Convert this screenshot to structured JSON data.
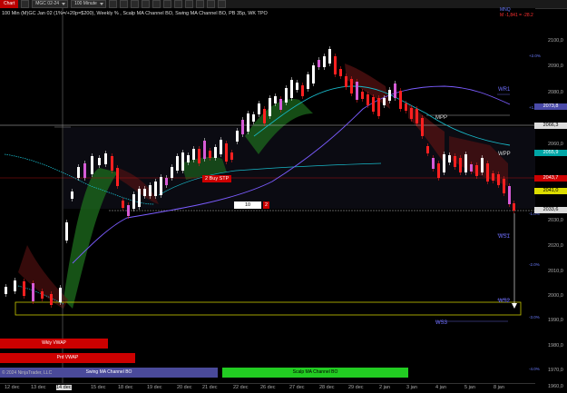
{
  "toolbar": {
    "chart_tab": "Chart",
    "instrument": "MGC 02-24",
    "interval": "100 Minute"
  },
  "caption": "100 Min (M)GC Jan 02 (1%=/+20p=$200), Weekly % , Scalp MA Channel BO, Swing MA Channel BO, PB 35p, WK TPO",
  "corner_top_right": {
    "label": "MNQ",
    "value": "M -1,841 = -28.2"
  },
  "price_axis": {
    "labels": [
      "2100,0",
      "2090,0",
      "2080,0",
      "2070,0",
      "2060,0",
      "2050,0",
      "2040,0",
      "2030,0",
      "2020,0",
      "2010,0",
      "2000,0",
      "1990,0",
      "1980,0",
      "1970,0",
      "1960,0"
    ],
    "percent_labels": [
      "+2.0%",
      "+1.0%",
      "-1.0%",
      "-2.0%",
      "-3.0%",
      "-4.0%"
    ],
    "tags": [
      {
        "text": "2073,8",
        "bg": "#4a4aa8",
        "fg": "#ffffff"
      },
      {
        "text": "2066,3",
        "bg": "#dddddd",
        "fg": "#000000"
      },
      {
        "text": "2055,9",
        "bg": "#00a6a6",
        "fg": "#ffffff"
      },
      {
        "text": "2043,7",
        "bg": "#cc0000",
        "fg": "#ffffff"
      },
      {
        "text": "2041,0",
        "bg": "#dddd00",
        "fg": "#000000"
      },
      {
        "text": "2033,6",
        "bg": "#dddddd",
        "fg": "#000000"
      }
    ]
  },
  "levels": [
    "WR1",
    "MPP",
    "WPP",
    "WS1",
    "WS2",
    "WS3"
  ],
  "markers": {
    "buy_stop": "2 Buy STP",
    "position_qty": "10",
    "position_alert": "2"
  },
  "legend_bars": {
    "wkly_vwap": "Wkly VWAP",
    "prd_vwap": "Prd VWAP",
    "swing": "Swing MA Channel BO",
    "scalp": "Scalp MA Channel BO"
  },
  "copyright": "© 2024 NinjaTrader, LLC",
  "time_axis": [
    "12 dec",
    "13 dec",
    "14 dec",
    "15 dec",
    "18 dec",
    "19 dec",
    "20 dec",
    "21 dec",
    "22 dec",
    "26 dec",
    "27 dec",
    "28 dec",
    "29 dec",
    "2 jan",
    "3 jan",
    "4 jan",
    "5 jan",
    "8 jan"
  ],
  "colors": {
    "bull": "#ffffff",
    "bear": "#ff2020",
    "cyan": "#18b8c8",
    "purple": "#7b5cff",
    "green_channel": "#1e6e1e",
    "red_channel": "#5a1212"
  }
}
